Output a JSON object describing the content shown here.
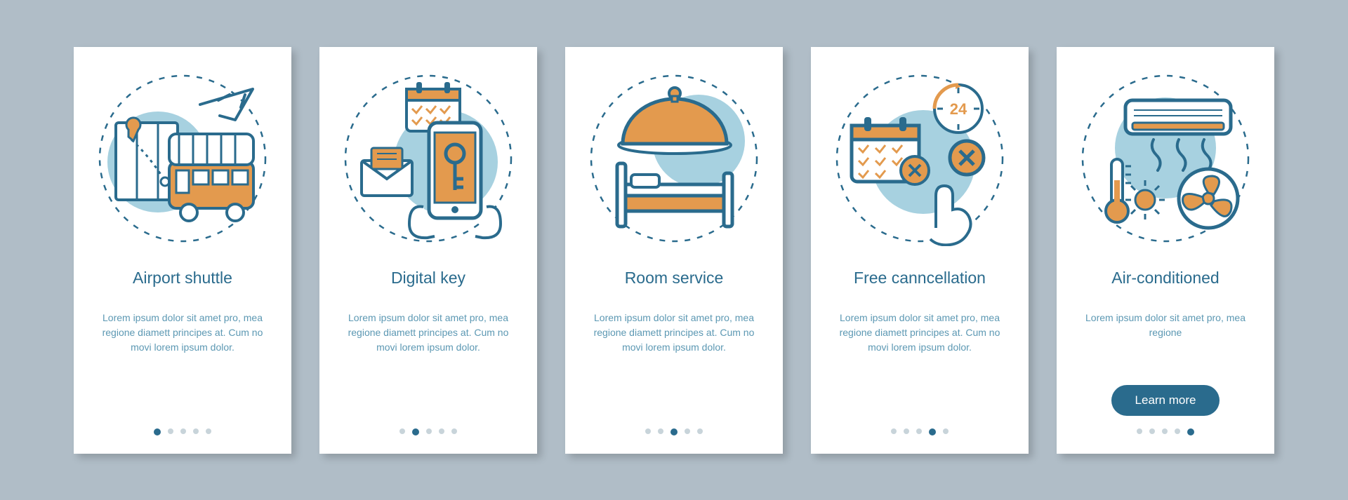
{
  "cards": [
    {
      "title": "Airport shuttle",
      "description": "Lorem ipsum dolor sit amet pro, mea regione diamett principes at. Cum no movi lorem ipsum dolor.",
      "activeDot": 0,
      "cta": null
    },
    {
      "title": "Digital key",
      "description": "Lorem ipsum dolor sit amet pro, mea regione diamett principes at. Cum no movi lorem ipsum dolor.",
      "activeDot": 1,
      "cta": null
    },
    {
      "title": "Room service",
      "description": "Lorem ipsum dolor sit amet pro, mea regione diamett principes at. Cum no movi lorem ipsum dolor.",
      "activeDot": 2,
      "cta": null
    },
    {
      "title": "Free canncellation",
      "description": "Lorem ipsum dolor sit amet pro, mea regione diamett principes at. Cum no movi lorem ipsum dolor.",
      "activeDot": 3,
      "cta": null
    },
    {
      "title": "Air-conditioned",
      "description": "Lorem ipsum dolor sit amet pro, mea regione",
      "activeDot": 4,
      "cta": "Learn more"
    }
  ],
  "colors": {
    "accent": "#2a6b8d",
    "orange": "#e39a4e",
    "lightblue": "#a7d1e0",
    "stroke": "#2a6b8d"
  },
  "dotCount": 5
}
